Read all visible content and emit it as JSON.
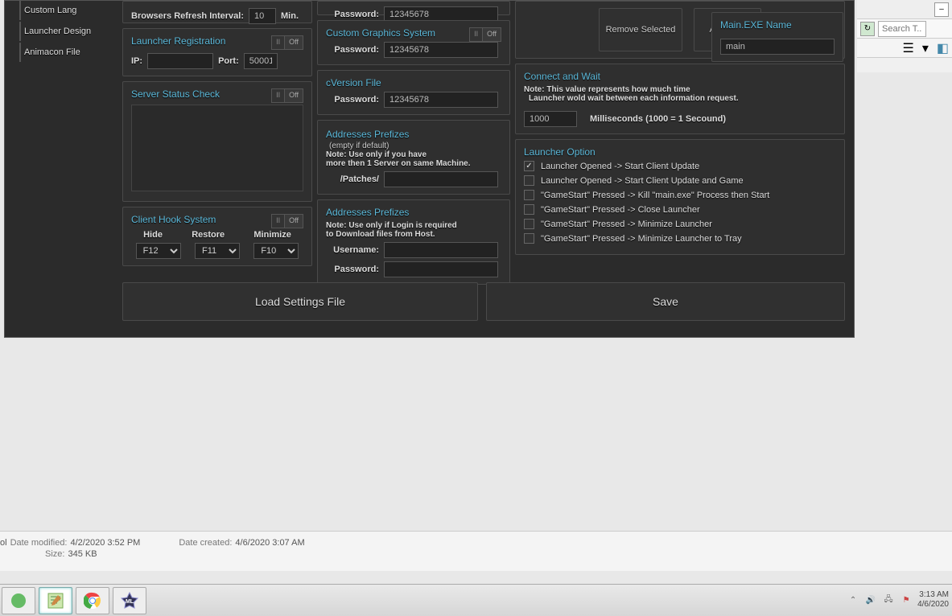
{
  "sidebar": {
    "items": [
      "Custom Lang",
      "Launcher Design",
      "Animacon File"
    ]
  },
  "col1": {
    "browsers_refresh_label": "Browsers Refresh Interval:",
    "browsers_refresh_value": "10",
    "browsers_refresh_unit": "Min.",
    "launcher_reg_title": "Launcher Registration",
    "ip_label": "IP:",
    "ip_value": "",
    "port_label": "Port:",
    "port_value": "50001",
    "server_status_title": "Server Status Check",
    "client_hook_title": "Client Hook System",
    "hide_label": "Hide",
    "restore_label": "Restore",
    "minimize_label": "Minimize",
    "hide_value": "F12",
    "restore_value": "F11",
    "minimize_value": "F10"
  },
  "col2": {
    "password_label": "Password:",
    "password_top_value": "12345678",
    "cgraphics_title": "Custom Graphics System",
    "cgraphics_pwd": "12345678",
    "cversion_title": "cVersion File",
    "cversion_pwd": "12345678",
    "addr1_title": "Addresses Prefizes",
    "addr1_hint": "(empty if default)",
    "addr1_note1": "Note: Use only if you have",
    "addr1_note2": "more then 1 Server on same Machine.",
    "addr1_value": "/Patches/",
    "addr2_title": "Addresses Prefizes",
    "addr2_note1": "Note: Use only if Login is required",
    "addr2_note2": "to Download files from Host.",
    "username_label": "Username:",
    "username_value": "",
    "password2_value": ""
  },
  "col3": {
    "remove_btn": "Remove Selected",
    "add_btn": "Add New",
    "connect_title": "Connect and Wait",
    "connect_note1": "Note: This value represents how much time",
    "connect_note2": "Launcher wold wait between each information request.",
    "connect_value": "1000",
    "connect_unit": "Milliseconds (1000 = 1 Secound)",
    "launcher_option_title": "Launcher Option",
    "options": [
      {
        "checked": true,
        "label": "Launcher Opened -> Start Client Update"
      },
      {
        "checked": false,
        "label": "Launcher Opened -> Start Client Update and Game"
      },
      {
        "checked": false,
        "label": "\"GameStart\" Pressed -> Kill \"main.exe\" Process then Start"
      },
      {
        "checked": false,
        "label": "\"GameStart\" Pressed -> Close Launcher"
      },
      {
        "checked": false,
        "label": "\"GameStart\" Pressed -> Minimize Launcher"
      },
      {
        "checked": false,
        "label": "\"GameStart\" Pressed -> Minimize Launcher to Tray"
      }
    ]
  },
  "col4": {
    "mainexe_title": "Main.EXE Name",
    "mainexe_value": "main"
  },
  "buttons": {
    "load": "Load Settings File",
    "save": "Save"
  },
  "toggle": {
    "on": "II",
    "off": "Off"
  },
  "details": {
    "mod_label": "Date modified:",
    "mod_value": "4/2/2020 3:52 PM",
    "created_label": "Date created:",
    "created_value": "4/6/2020 3:07 AM",
    "size_label": "Size:",
    "size_value": "345 KB",
    "prefix": "ol"
  },
  "right": {
    "search_placeholder": "Search T..."
  },
  "tray": {
    "time": "3:13 AM",
    "date": "4/6/2020"
  }
}
